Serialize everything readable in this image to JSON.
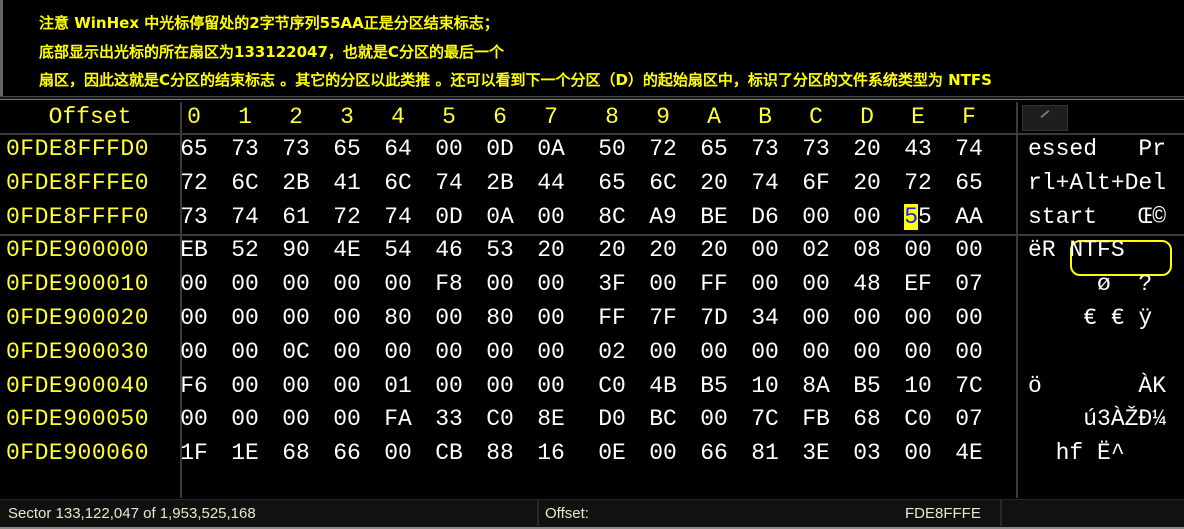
{
  "annotation": {
    "lines": [
      "注意 WinHex 中光标停留处的2字节序列55AA正是分区结束标志；",
      "底部显示出光标的所在扇区为133122047，也就是C分区的最后一个",
      "扇区，因此这就是C分区的结束标志 。其它的分区以此类推  。还可以看到下一个分区（D）的起始扇区中，标识了分区的文件系统类型为 NTFS"
    ]
  },
  "hex_editor": {
    "offset_header": "Offset",
    "columns": [
      "0",
      "1",
      "2",
      "3",
      "4",
      "5",
      "6",
      "7",
      "8",
      "9",
      "A",
      "B",
      "C",
      "D",
      "E",
      "F"
    ],
    "rows": [
      {
        "offset": "0FDE8FFFD0",
        "bytes": [
          "65",
          "73",
          "73",
          "65",
          "64",
          "00",
          "0D",
          "0A",
          "50",
          "72",
          "65",
          "73",
          "73",
          "20",
          "43",
          "74"
        ],
        "text": "essed   Pr"
      },
      {
        "offset": "0FDE8FFFE0",
        "bytes": [
          "72",
          "6C",
          "2B",
          "41",
          "6C",
          "74",
          "2B",
          "44",
          "65",
          "6C",
          "20",
          "74",
          "6F",
          "20",
          "72",
          "65"
        ],
        "text": "rl+Alt+Del"
      },
      {
        "offset": "0FDE8FFFF0",
        "bytes": [
          "73",
          "74",
          "61",
          "72",
          "74",
          "0D",
          "0A",
          "00",
          "8C",
          "A9",
          "BE",
          "D6",
          "00",
          "00",
          "55",
          "AA"
        ],
        "text": "start   Œ©"
      },
      {
        "offset": "0FDE900000",
        "bytes": [
          "EB",
          "52",
          "90",
          "4E",
          "54",
          "46",
          "53",
          "20",
          "20",
          "20",
          "20",
          "00",
          "02",
          "08",
          "00",
          "00"
        ],
        "text": "ëR NTFS"
      },
      {
        "offset": "0FDE900010",
        "bytes": [
          "00",
          "00",
          "00",
          "00",
          "00",
          "F8",
          "00",
          "00",
          "3F",
          "00",
          "FF",
          "00",
          "00",
          "48",
          "EF",
          "07"
        ],
        "text": "     ø  ?"
      },
      {
        "offset": "0FDE900020",
        "bytes": [
          "00",
          "00",
          "00",
          "00",
          "80",
          "00",
          "80",
          "00",
          "FF",
          "7F",
          "7D",
          "34",
          "00",
          "00",
          "00",
          "00"
        ],
        "text": "    € € ÿ"
      },
      {
        "offset": "0FDE900030",
        "bytes": [
          "00",
          "00",
          "0C",
          "00",
          "00",
          "00",
          "00",
          "00",
          "02",
          "00",
          "00",
          "00",
          "00",
          "00",
          "00",
          "00"
        ],
        "text": ""
      },
      {
        "offset": "0FDE900040",
        "bytes": [
          "F6",
          "00",
          "00",
          "00",
          "01",
          "00",
          "00",
          "00",
          "C0",
          "4B",
          "B5",
          "10",
          "8A",
          "B5",
          "10",
          "7C"
        ],
        "text": "ö       ÀK"
      },
      {
        "offset": "0FDE900050",
        "bytes": [
          "00",
          "00",
          "00",
          "00",
          "FA",
          "33",
          "C0",
          "8E",
          "D0",
          "BC",
          "00",
          "7C",
          "FB",
          "68",
          "C0",
          "07"
        ],
        "text": "    ú3ÀŽÐ¼"
      },
      {
        "offset": "0FDE900060",
        "bytes": [
          "1F",
          "1E",
          "68",
          "66",
          "00",
          "CB",
          "88",
          "16",
          "0E",
          "00",
          "66",
          "81",
          "3E",
          "03",
          "00",
          "4E"
        ],
        "text": "  hf Ë^"
      }
    ],
    "cursor": {
      "row": 2,
      "col": 14,
      "highlight_char": "5"
    },
    "highlight_color": "#ffff00"
  },
  "status_bar": {
    "sector": "Sector 133,122,047 of 1,953,525,168",
    "offset_label": "Offset:",
    "offset_value": "FDE8FFFE"
  }
}
